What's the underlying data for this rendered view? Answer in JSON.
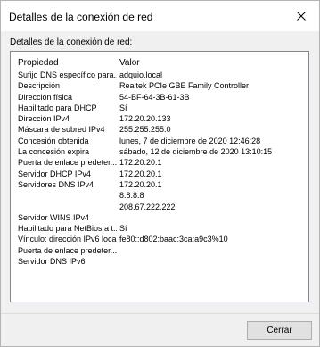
{
  "window": {
    "title": "Detalles de la conexión de red"
  },
  "group": {
    "label": "Detalles de la conexión de red:"
  },
  "table": {
    "headers": {
      "property": "Propiedad",
      "value": "Valor"
    },
    "rows": [
      {
        "property": "Sufijo DNS específico para...",
        "value": "adquio.local"
      },
      {
        "property": "Descripción",
        "value": "Realtek PCIe GBE Family Controller"
      },
      {
        "property": "Dirección física",
        "value": "54-BF-64-3B-61-3B"
      },
      {
        "property": "Habilitado para DHCP",
        "value": "Sí"
      },
      {
        "property": "Dirección IPv4",
        "value": "172.20.20.133"
      },
      {
        "property": "Máscara de subred IPv4",
        "value": "255.255.255.0"
      },
      {
        "property": "Concesión obtenida",
        "value": "lunes, 7 de diciembre de 2020 12:46:28"
      },
      {
        "property": "La concesión expira",
        "value": "sábado, 12 de diciembre de 2020 13:10:15"
      },
      {
        "property": "Puerta de enlace predeter...",
        "value": "172.20.20.1"
      },
      {
        "property": "Servidor DHCP IPv4",
        "value": "172.20.20.1"
      },
      {
        "property": "Servidores DNS IPv4",
        "value": "172.20.20.1"
      },
      {
        "property": "",
        "value": "8.8.8.8"
      },
      {
        "property": "",
        "value": "208.67.222.222"
      },
      {
        "property": "Servidor WINS IPv4",
        "value": ""
      },
      {
        "property": "Habilitado para NetBios a t...",
        "value": "Sí"
      },
      {
        "property": "Vínculo: dirección IPv6 local",
        "value": "fe80::d802:baac:3ca:a9c3%10"
      },
      {
        "property": "Puerta de enlace predeter...",
        "value": ""
      },
      {
        "property": "Servidor DNS IPv6",
        "value": ""
      }
    ]
  },
  "footer": {
    "close_label": "Cerrar"
  }
}
